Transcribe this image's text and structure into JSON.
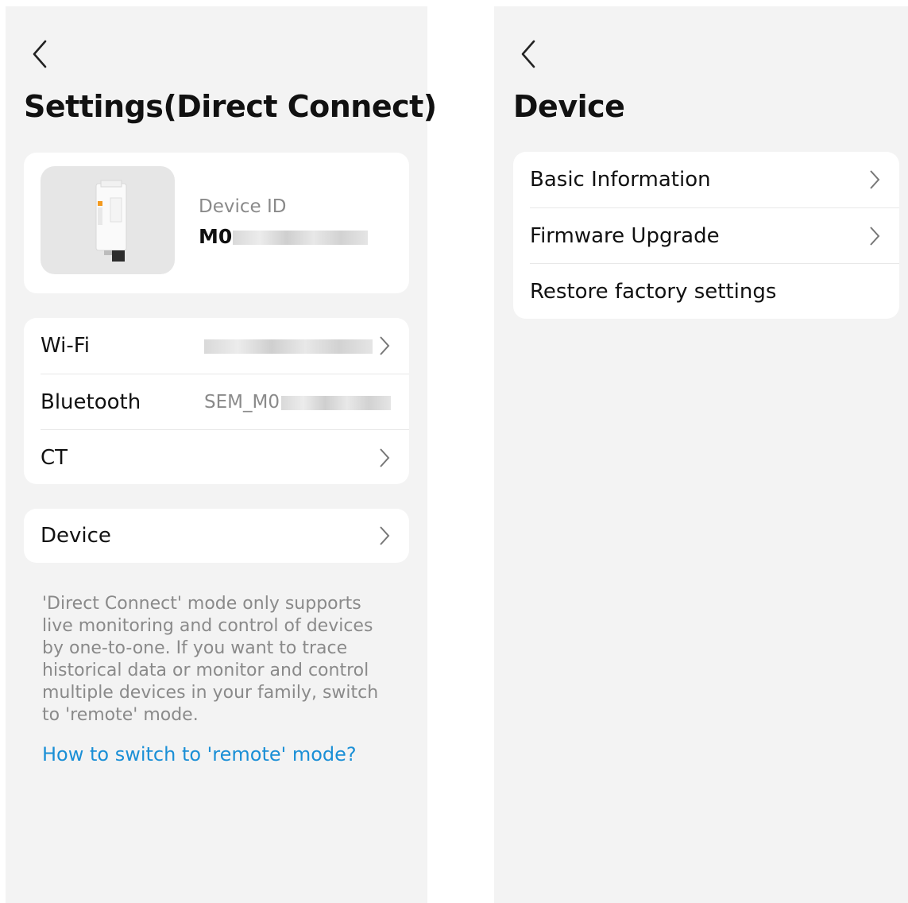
{
  "left_screen": {
    "title": "Settings(Direct Connect)",
    "device_card": {
      "id_label": "Device ID",
      "id_value_visible": "M0"
    },
    "rows": [
      {
        "label": "Wi-Fi",
        "value": ""
      },
      {
        "label": "Bluetooth",
        "value": "SEM_M0"
      },
      {
        "label": "CT",
        "value": ""
      }
    ],
    "device_row": {
      "label": "Device"
    },
    "note": "'Direct Connect' mode only supports live monitoring and control of devices by one-to-one. If you want to trace historical data or monitor and control multiple devices in your family, switch to 'remote' mode.",
    "link": "How to switch to 'remote' mode?"
  },
  "right_screen": {
    "title": "Device",
    "items": [
      {
        "label": "Basic Information",
        "chevron": true
      },
      {
        "label": "Firmware Upgrade",
        "chevron": true
      },
      {
        "label": "Restore factory settings",
        "chevron": false
      }
    ]
  },
  "colors": {
    "background": "#f3f3f3",
    "card": "#ffffff",
    "link": "#1a8fd6",
    "muted_text": "#8a8a8a"
  },
  "icons": [
    "back-icon",
    "chevron-right-icon",
    "device-image"
  ]
}
